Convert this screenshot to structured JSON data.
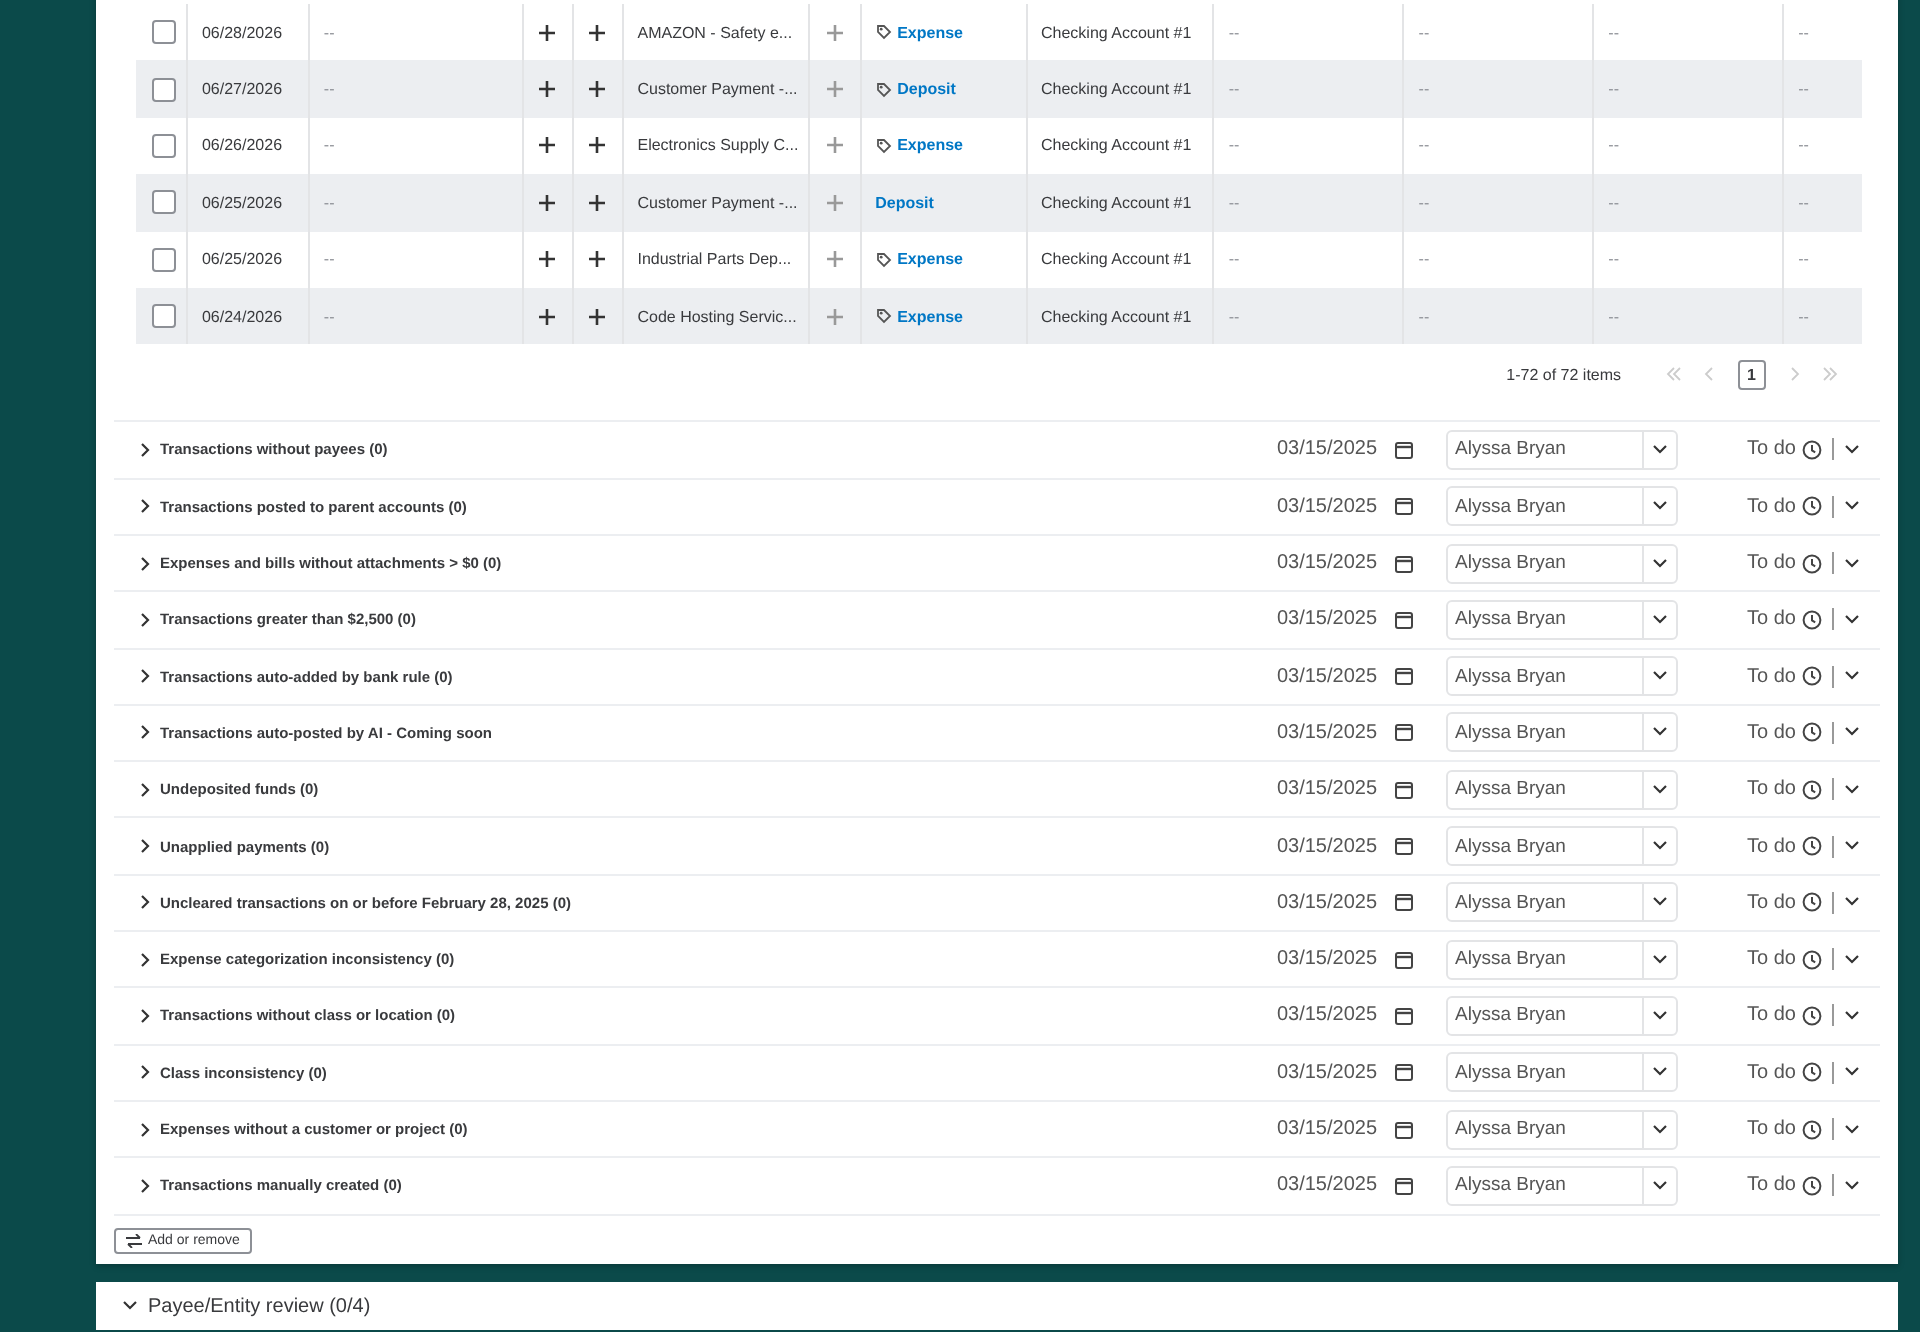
{
  "table": {
    "rows": [
      {
        "checked": false,
        "date": "06/28/2026",
        "column_3": "--",
        "description": "AMAZON - Safety e...",
        "type": "Expense",
        "tagged": true,
        "account": "Checking Account #1",
        "more": [
          "--",
          "--",
          "--",
          "--"
        ]
      },
      {
        "checked": false,
        "date": "06/27/2026",
        "column_3": "--",
        "description": "Customer Payment -...",
        "type": "Deposit",
        "tagged": true,
        "account": "Checking Account #1",
        "more": [
          "--",
          "--",
          "--",
          "--"
        ]
      },
      {
        "checked": false,
        "date": "06/26/2026",
        "column_3": "--",
        "description": "Electronics Supply C...",
        "type": "Expense",
        "tagged": true,
        "account": "Checking Account #1",
        "more": [
          "--",
          "--",
          "--",
          "--"
        ]
      },
      {
        "checked": false,
        "date": "06/25/2026",
        "column_3": "--",
        "description": "Customer Payment -...",
        "type": "Deposit",
        "tagged": false,
        "account": "Checking Account #1",
        "more": [
          "--",
          "--",
          "--",
          "--"
        ]
      },
      {
        "checked": false,
        "date": "06/25/2026",
        "column_3": "--",
        "description": "Industrial Parts Dep...",
        "type": "Expense",
        "tagged": true,
        "account": "Checking Account #1",
        "more": [
          "--",
          "--",
          "--",
          "--"
        ]
      },
      {
        "checked": false,
        "date": "06/24/2026",
        "column_3": "--",
        "description": "Code Hosting Servic...",
        "type": "Expense",
        "tagged": true,
        "account": "Checking Account #1",
        "more": [
          "--",
          "--",
          "--",
          "--"
        ]
      }
    ]
  },
  "pagination": {
    "summary": "1-72 of 72 items",
    "pages": [
      {
        "label": "1",
        "selected": true
      }
    ]
  },
  "checklist": {
    "items": [
      {
        "title": "Transactions without payees (0)",
        "expanded": false,
        "date": "03/15/2025",
        "assignee": "Alyssa Bryan",
        "status": "To do"
      },
      {
        "title": "Transactions posted to parent accounts (0)",
        "expanded": false,
        "date": "03/15/2025",
        "assignee": "Alyssa Bryan",
        "status": "To do"
      },
      {
        "title": "Expenses and bills without attachments > $0 (0)",
        "expanded": false,
        "date": "03/15/2025",
        "assignee": "Alyssa Bryan",
        "status": "To do"
      },
      {
        "title": "Transactions greater than $2,500 (0)",
        "expanded": false,
        "date": "03/15/2025",
        "assignee": "Alyssa Bryan",
        "status": "To do"
      },
      {
        "title": "Transactions auto-added by bank rule (0)",
        "expanded": false,
        "date": "03/15/2025",
        "assignee": "Alyssa Bryan",
        "status": "To do"
      },
      {
        "title": "Transactions auto-posted by AI - Coming soon",
        "expanded": false,
        "date": "03/15/2025",
        "assignee": "Alyssa Bryan",
        "status": "To do"
      },
      {
        "title": "Undeposited funds (0)",
        "expanded": false,
        "date": "03/15/2025",
        "assignee": "Alyssa Bryan",
        "status": "To do"
      },
      {
        "title": "Unapplied payments (0)",
        "expanded": false,
        "date": "03/15/2025",
        "assignee": "Alyssa Bryan",
        "status": "To do"
      },
      {
        "title": "Uncleared transactions on or before February 28, 2025 (0)",
        "expanded": false,
        "date": "03/15/2025",
        "assignee": "Alyssa Bryan",
        "status": "To do"
      },
      {
        "title": "Expense categorization inconsistency (0)",
        "expanded": false,
        "date": "03/15/2025",
        "assignee": "Alyssa Bryan",
        "status": "To do"
      },
      {
        "title": "Transactions without class or location (0)",
        "expanded": false,
        "date": "03/15/2025",
        "assignee": "Alyssa Bryan",
        "status": "To do"
      },
      {
        "title": "Class inconsistency (0)",
        "expanded": false,
        "date": "03/15/2025",
        "assignee": "Alyssa Bryan",
        "status": "To do"
      },
      {
        "title": "Expenses without a customer or project (0)",
        "expanded": false,
        "date": "03/15/2025",
        "assignee": "Alyssa Bryan",
        "status": "To do"
      },
      {
        "title": "Transactions manually created (0)",
        "expanded": false,
        "date": "03/15/2025",
        "assignee": "Alyssa Bryan",
        "status": "To do"
      }
    ],
    "add_button": "Add or remove"
  },
  "next_section": {
    "title": "Payee/Entity review (0/4)"
  }
}
